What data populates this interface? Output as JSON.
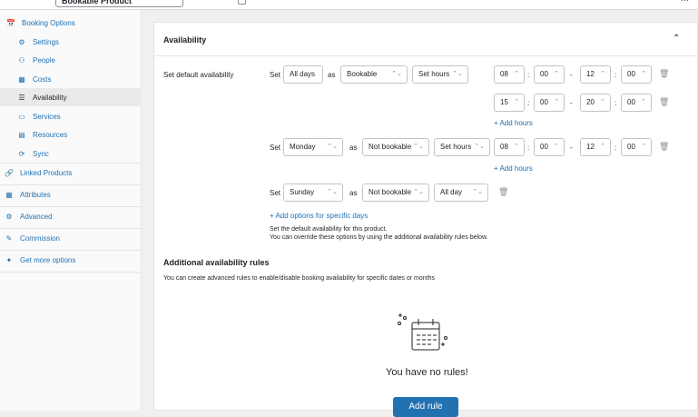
{
  "topbar": {
    "product_type": "Bookable Product",
    "settings_icon": "gear-icon"
  },
  "sidebar": {
    "items": [
      {
        "label": "Booking Options",
        "icon": "calendar-icon"
      },
      {
        "label": "Settings",
        "icon": "gear-icon"
      },
      {
        "label": "People",
        "icon": "people-icon"
      },
      {
        "label": "Costs",
        "icon": "chart-icon"
      },
      {
        "label": "Availability",
        "icon": "list-icon"
      },
      {
        "label": "Services",
        "icon": "window-icon"
      },
      {
        "label": "Resources",
        "icon": "card-icon"
      },
      {
        "label": "Sync",
        "icon": "sync-icon"
      },
      {
        "label": "Linked Products",
        "icon": "link-icon"
      },
      {
        "label": "Attributes",
        "icon": "table-icon"
      },
      {
        "label": "Advanced",
        "icon": "gear-icon"
      },
      {
        "label": "Commission",
        "icon": "wrench-icon"
      },
      {
        "label": "Get more options",
        "icon": "plug-icon"
      }
    ]
  },
  "section": {
    "title": "Availability"
  },
  "default": {
    "label": "Set default availability",
    "set": "Set",
    "as": "as",
    "rules": [
      {
        "day": "All days",
        "status": "Bookable",
        "mode": "Set hours",
        "hours": [
          {
            "from_h": "08",
            "from_m": "00",
            "to_h": "12",
            "to_m": "00"
          },
          {
            "from_h": "15",
            "from_m": "00",
            "to_h": "20",
            "to_m": "00"
          }
        ]
      },
      {
        "day": "Monday",
        "status": "Not bookable",
        "mode": "Set hours",
        "hours": [
          {
            "from_h": "08",
            "from_m": "00",
            "to_h": "12",
            "to_m": "00"
          }
        ]
      },
      {
        "day": "Sunday",
        "status": "Not bookable",
        "mode": "All day"
      }
    ],
    "add_hours": "+ Add hours",
    "add_options": "+ Add options for specific days",
    "note1": "Set the default availability for this product.",
    "note2": "You can override these options by using the additional availability rules below."
  },
  "additional": {
    "title": "Additional availability rules",
    "desc": "You can create advanced rules to enable/disable booking availability for specific dates or months",
    "empty": "You have no rules!",
    "add_rule": "Add rule"
  }
}
